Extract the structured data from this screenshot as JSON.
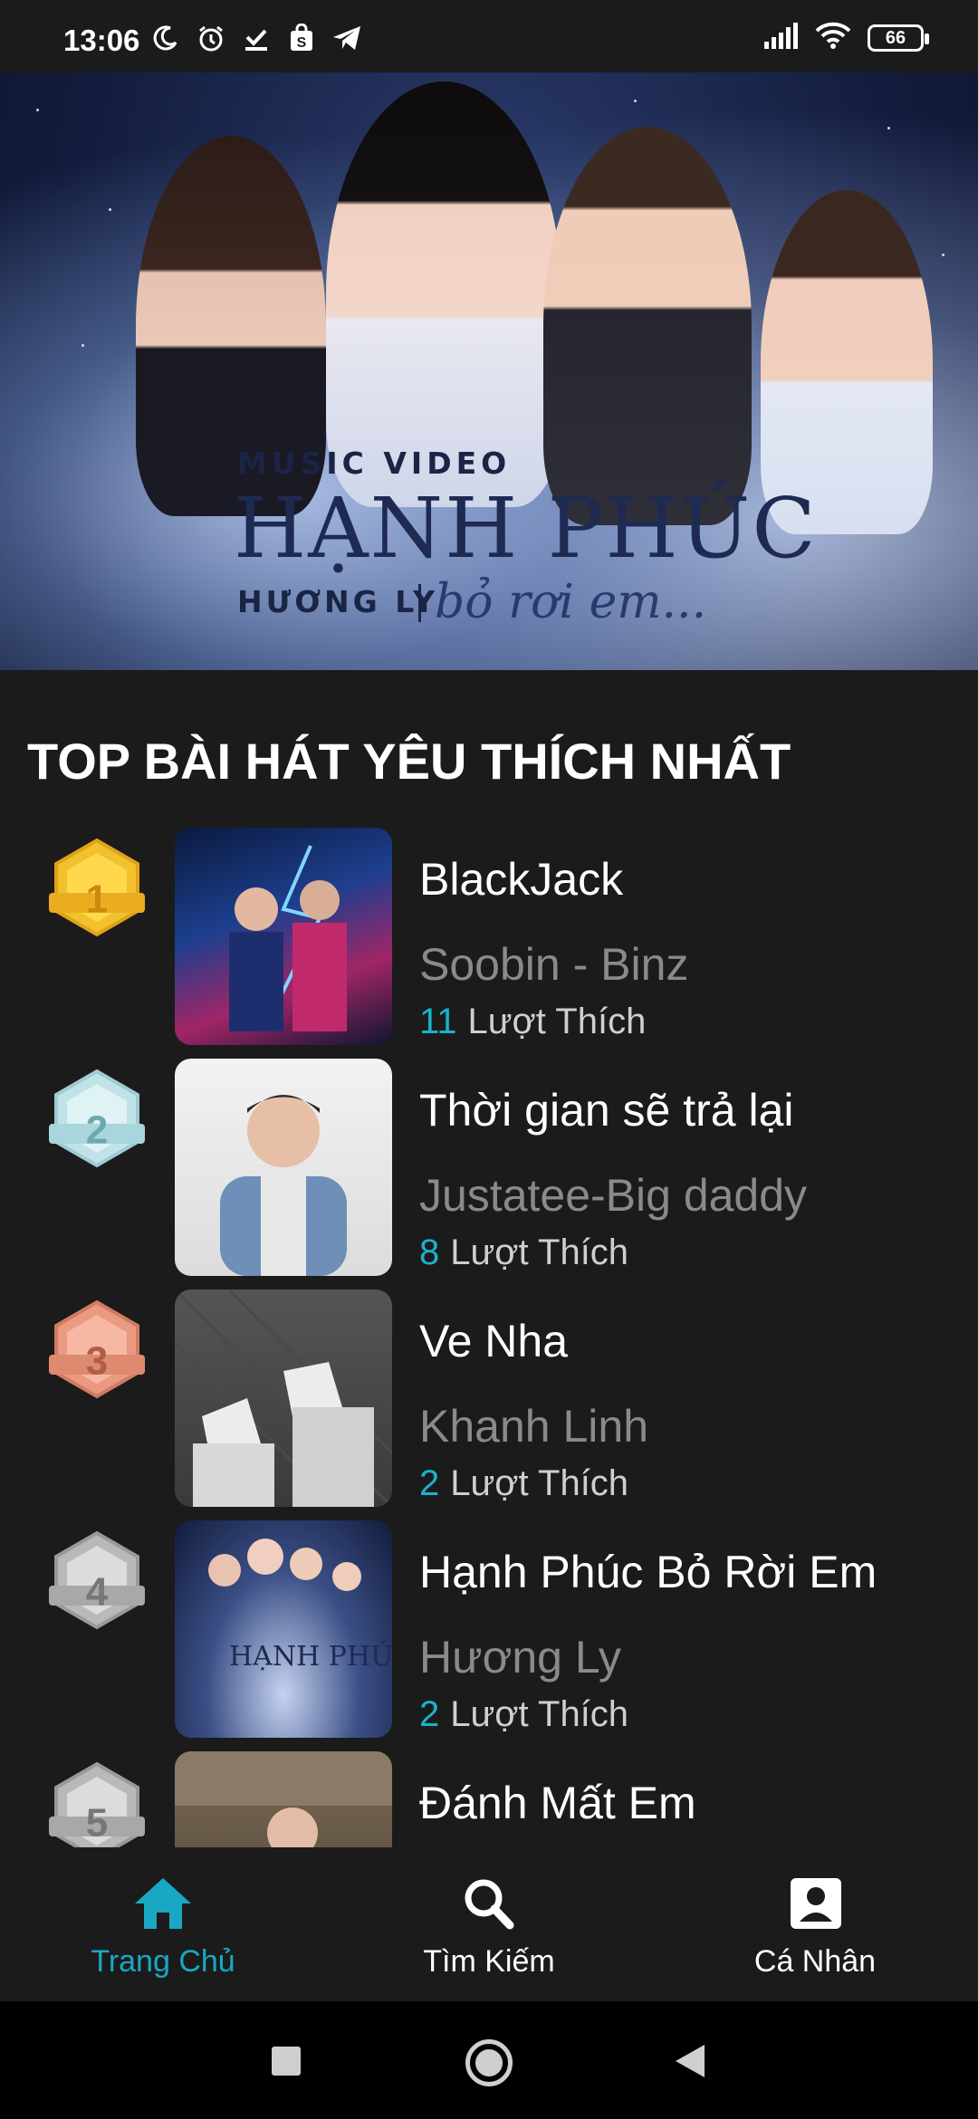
{
  "status_bar": {
    "time": "13:06",
    "battery": "66"
  },
  "banner": {
    "label": "MUSIC VIDEO",
    "title": "HẠNH PHÚC",
    "artist": "HƯƠNG LY",
    "subtitle": "bỏ rơi em...",
    "active_slide": 2,
    "slide_count": 5
  },
  "section": {
    "title": "TOP BÀI HÁT YÊU THÍCH NHẤT"
  },
  "songs": [
    {
      "rank": "1",
      "title": "BlackJack",
      "artist": "Soobin - Binz",
      "likes": "11",
      "likes_label": "Lượt Thích",
      "medal_color": "#f2c12e"
    },
    {
      "rank": "2",
      "title": "Thời gian sẽ trả lại",
      "artist": "Justatee-Big daddy",
      "likes": "8",
      "likes_label": "Lượt Thích",
      "medal_color": "#bfe3e8"
    },
    {
      "rank": "3",
      "title": "Ve Nha",
      "artist": "Khanh Linh",
      "likes": "2",
      "likes_label": "Lượt Thích",
      "medal_color": "#e99a80"
    },
    {
      "rank": "4",
      "title": "Hạnh Phúc Bỏ Rời Em",
      "artist": "Hương Ly",
      "likes": "2",
      "likes_label": "Lượt Thích",
      "medal_color": "#b9b9b9"
    },
    {
      "rank": "5",
      "title": "Đánh Mất Em",
      "artist": "",
      "likes": "",
      "likes_label": "",
      "medal_color": "#b9b9b9"
    }
  ],
  "bottom_nav": {
    "home": "Trang Chủ",
    "search": "Tìm Kiếm",
    "profile": "Cá Nhân"
  },
  "colors": {
    "accent": "#1aa7c3",
    "background": "#1b1b1b"
  }
}
